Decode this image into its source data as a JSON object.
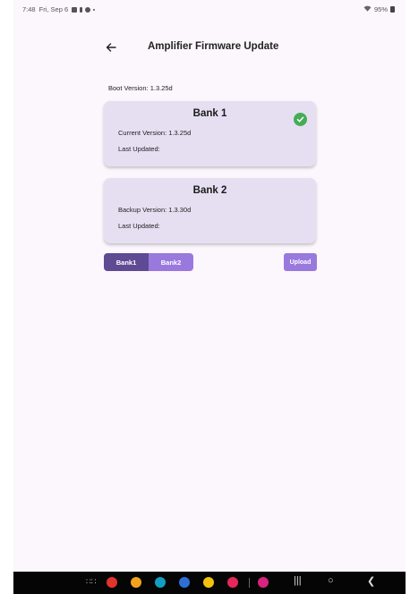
{
  "status": {
    "time": "7:48",
    "date": "Fri, Sep 6",
    "battery": "95%"
  },
  "app_bar": {
    "title": "Amplifier Firmware Update"
  },
  "boot_version": "Boot Version: 1.3.25d",
  "bank1": {
    "title": "Bank 1",
    "version_line": "Current Version: 1.3.25d",
    "updated_line": "Last Updated:",
    "status_icon": "check-circle-icon",
    "status_color": "#45ad55"
  },
  "bank2": {
    "title": "Bank 2",
    "version_line": "Backup Version: 1.3.30d",
    "updated_line": "Last Updated:"
  },
  "bank_selector": {
    "options": [
      "Bank1",
      "Bank2"
    ],
    "selected": "Bank1"
  },
  "upload_label": "Upload",
  "colors": {
    "card": "#e6dff2",
    "segment_selected": "#5f4a94",
    "segment_unselected": "#9a79de",
    "background": "#fcf7fd"
  },
  "nav_apps": [
    {
      "icon": "app-icon-red",
      "color": "#e3332d"
    },
    {
      "icon": "app-icon-orange",
      "color": "#f3a21c"
    },
    {
      "icon": "app-icon-teal",
      "color": "#129ec2"
    },
    {
      "icon": "app-icon-blue",
      "color": "#2d6fd6"
    },
    {
      "icon": "chrome-icon",
      "color": "#f2c20d"
    },
    {
      "icon": "app-icon-pink",
      "color": "#e4285a"
    },
    {
      "icon": "app-icon-magenta",
      "color": "#d8237f"
    }
  ]
}
